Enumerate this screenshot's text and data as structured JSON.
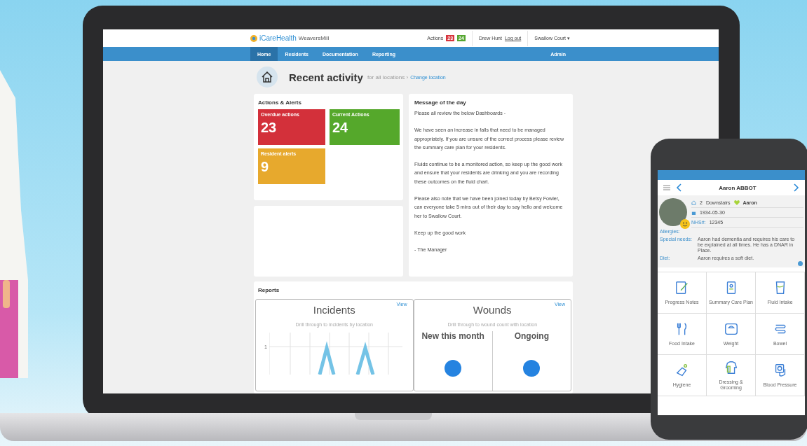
{
  "app": {
    "logo": "iCareHealth",
    "site": "WeaversMill",
    "actions_label": "Actions",
    "action_badges": [
      {
        "count": "23",
        "color": "#d8353d"
      },
      {
        "count": "24",
        "color": "#55a630"
      }
    ],
    "user": "Drew Hunt",
    "logout": "Log out",
    "location": "Swallow Court ▾"
  },
  "nav": [
    {
      "label": "Home",
      "selected": true
    },
    {
      "label": "Residents",
      "selected": false
    },
    {
      "label": "Documentation",
      "selected": false
    },
    {
      "label": "Reporting",
      "selected": false
    }
  ],
  "admin": "Admin",
  "page": {
    "title": "Recent activity",
    "scope": "for all locations",
    "separator": "›",
    "change_link": "Change location"
  },
  "actions_alerts": {
    "title": "Actions & Alerts",
    "tiles": [
      {
        "label": "Overdue actions",
        "count": "23",
        "color": "#d3303a"
      },
      {
        "label": "Current Actions",
        "count": "24",
        "color": "#55a82b"
      },
      {
        "label": "Resident alerts",
        "count": "9",
        "color": "#e7a92d"
      }
    ]
  },
  "message": {
    "title": "Message of the day",
    "paragraphs": [
      "Please all review the below Dashboards -",
      "We have seen an increase in falls that need to be managed appropriately. If you are unsure of the correct process please review the summary care plan for your residents.",
      "Fluids continue to be a monitored action, so keep up the good work and ensure that your residents are drinking and you are recording these outcomes on the fluid chart.",
      "Please also note that we have been joined today by Betsy Fowler, can everyone take 5 mins out of their day to say hello and welcome her to Swallow Court.",
      "Keep up the good work",
      "- The Manager"
    ]
  },
  "reports": {
    "title": "Reports",
    "panels": [
      {
        "kind": "chart",
        "title": "Incidents",
        "view": "View",
        "subtitle": "Drill through to incidents by location",
        "y_tick": "1"
      },
      {
        "kind": "counts",
        "title": "Wounds",
        "view": "View",
        "subtitle": "Drill through to wound count with location",
        "columns": [
          "New this month",
          "Ongoing"
        ]
      }
    ]
  },
  "phone": {
    "title": "Aaron ABBOT",
    "room": "2",
    "unit": "Downstairs",
    "preferred_name": "Aaron",
    "dob": "1934-05-30",
    "nhs_label": "NHS#:",
    "nhs": "12345",
    "allergies_label": "Allergies:",
    "details": [
      {
        "label": "Special needs:",
        "value": "Aaron had dementia and requires his care to be explained at all times. He has a DNAR in Place."
      },
      {
        "label": "Diet:",
        "value": "Aaron requires a soft diet."
      }
    ],
    "tiles": [
      "Progress Notes",
      "Summary Care Plan",
      "Fluid Intake",
      "Food Intake",
      "Weight",
      "Bowel",
      "Hygiene",
      "Dressing & Grooming",
      "Blood Pressure"
    ]
  }
}
